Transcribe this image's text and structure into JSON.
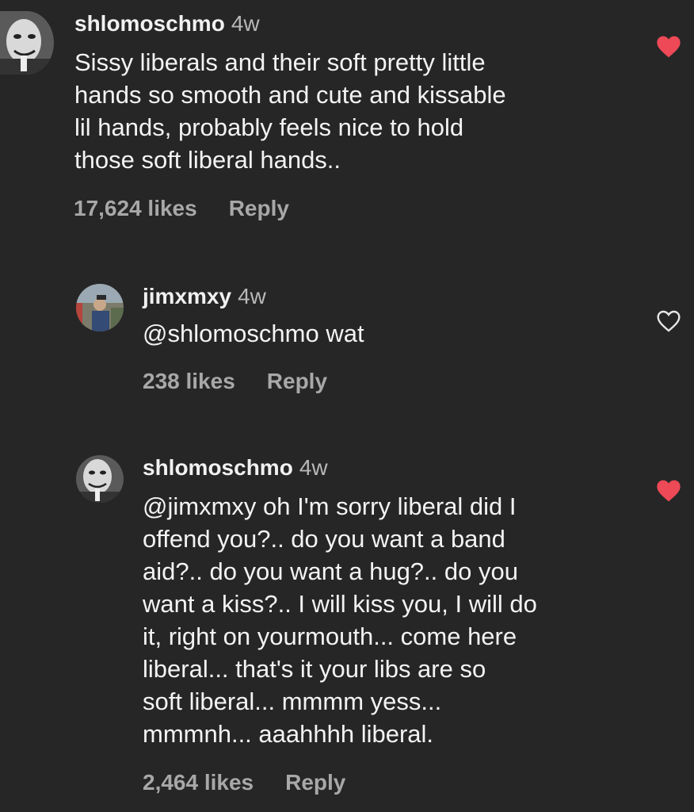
{
  "comments": [
    {
      "username": "shlomoschmo",
      "age": "4w",
      "text": "Sissy liberals and their soft pretty little\nhands so smooth and cute and kissable\nlil hands, probably feels nice to hold\nthose soft liberal hands..",
      "likes": "17,624 likes",
      "reply": "Reply",
      "liked": true
    },
    {
      "username": "jimxmxy",
      "age": "4w",
      "text": "@shlomoschmo wat",
      "likes": "238 likes",
      "reply": "Reply",
      "liked": false
    },
    {
      "username": "shlomoschmo",
      "age": "4w",
      "text": "@jimxmxy  oh I'm sorry liberal did I\noffend you?.. do you want a band\naid?.. do you want a hug?.. do you\nwant a kiss?.. I will kiss you, I will do\nit, right on yourmouth... come here\nliberal... that's it your libs are so\nsoft liberal... mmmm yess...\nmmmnh... aaahhhh liberal.",
      "likes": "2,464 likes",
      "reply": "Reply",
      "liked": true
    }
  ],
  "colors": {
    "background": "#262626",
    "heart_liked": "#ed4956",
    "meta_text": "#a8a8a8"
  },
  "icons": {
    "liked": "heart-filled-icon",
    "unliked": "heart-outline-icon"
  }
}
